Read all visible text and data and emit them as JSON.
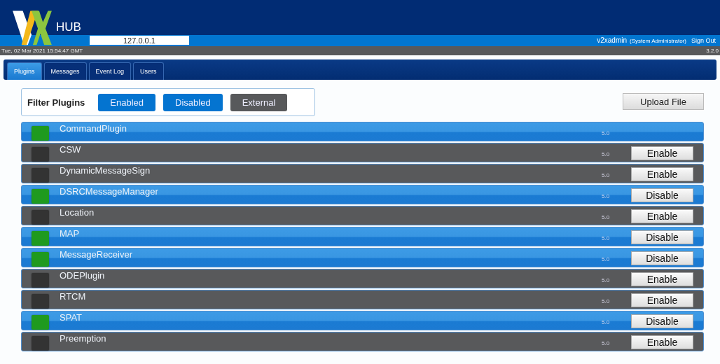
{
  "header": {
    "logo_text": "HUB",
    "address": "127.0.0.1",
    "user": "v2xadmin",
    "role": "(System Administrator)",
    "sign_out": "Sign Out"
  },
  "status_bar": {
    "datetime": "Tue, 02 Mar 2021 15:54:47 GMT",
    "version": "3.2.0"
  },
  "tabs": [
    {
      "label": "Plugins",
      "selected": true
    },
    {
      "label": "Messages",
      "selected": false
    },
    {
      "label": "Event Log",
      "selected": false
    },
    {
      "label": "Users",
      "selected": false
    }
  ],
  "filter": {
    "title": "Filter Plugins",
    "options": [
      {
        "label": "Enabled",
        "selected": true
      },
      {
        "label": "Disabled",
        "selected": true
      },
      {
        "label": "External",
        "selected": false
      }
    ]
  },
  "upload_button": "Upload File",
  "plugins": [
    {
      "name": "CommandPlugin",
      "version": "5.0",
      "enabled": true
    },
    {
      "name": "CSW",
      "version": "5.0",
      "enabled": false,
      "action": "Enable"
    },
    {
      "name": "DynamicMessageSign",
      "version": "5.0",
      "enabled": false,
      "action": "Enable"
    },
    {
      "name": "DSRCMessageManager",
      "version": "5.0",
      "enabled": true,
      "action": "Disable"
    },
    {
      "name": "Location",
      "version": "5.0",
      "enabled": false,
      "action": "Enable"
    },
    {
      "name": "MAP",
      "version": "5.0",
      "enabled": true,
      "action": "Disable"
    },
    {
      "name": "MessageReceiver",
      "version": "5.0",
      "enabled": true,
      "action": "Disable"
    },
    {
      "name": "ODEPlugin",
      "version": "5.0",
      "enabled": false,
      "action": "Enable"
    },
    {
      "name": "RTCM",
      "version": "5.0",
      "enabled": false,
      "action": "Enable"
    },
    {
      "name": "SPAT",
      "version": "5.0",
      "enabled": true,
      "action": "Disable"
    },
    {
      "name": "Preemption",
      "version": "5.0",
      "enabled": false,
      "action": "Enable"
    }
  ]
}
